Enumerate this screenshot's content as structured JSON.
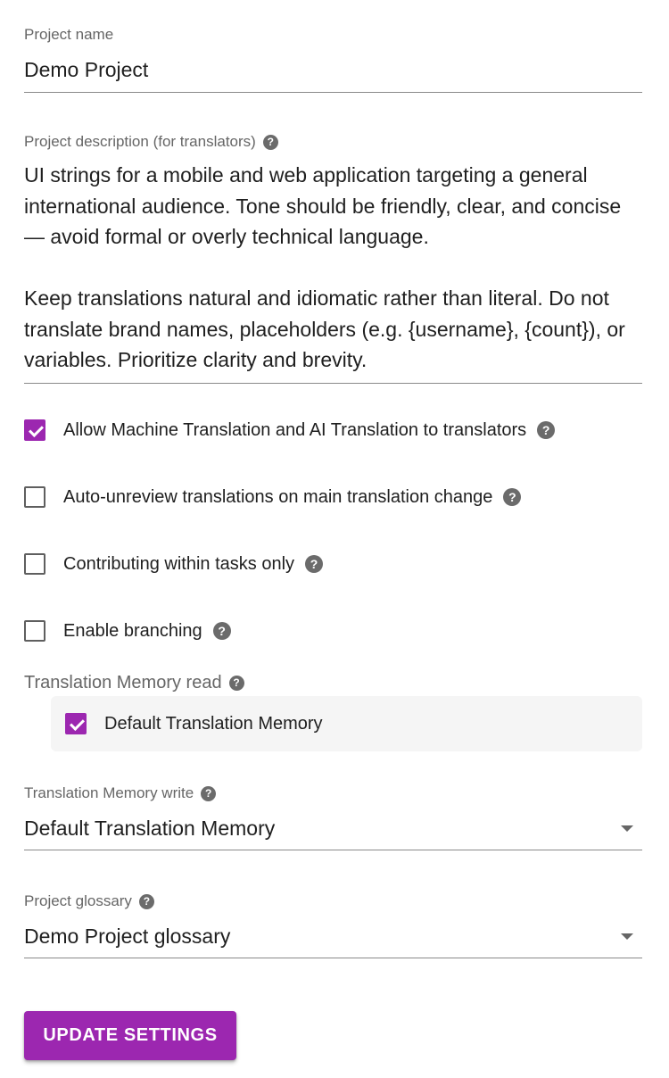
{
  "project_name": {
    "label": "Project name",
    "value": "Demo Project"
  },
  "project_description": {
    "label": "Project description (for translators)",
    "paragraphs": [
      "UI strings for a mobile and web application targeting a general international audience. Tone should be friendly, clear, and concise — avoid formal or overly technical language.",
      "Keep translations natural and idiomatic rather than literal. Do not translate brand names, placeholders (e.g. {username}, {count}), or variables. Prioritize clarity and brevity."
    ]
  },
  "options": {
    "machine_translation": {
      "label": "Allow Machine Translation and AI Translation to translators",
      "checked": true
    },
    "auto_unreview": {
      "label": "Auto-unreview translations on main translation change",
      "checked": false
    },
    "tasks_only": {
      "label": "Contributing within tasks only",
      "checked": false
    },
    "branching": {
      "label": "Enable branching",
      "checked": false
    }
  },
  "tm_read": {
    "label": "Translation Memory read",
    "items": [
      {
        "label": "Default Translation Memory",
        "checked": true
      }
    ]
  },
  "tm_write": {
    "label": "Translation Memory write",
    "value": "Default Translation Memory"
  },
  "glossary": {
    "label": "Project glossary",
    "value": "Demo Project glossary"
  },
  "actions": {
    "update_label": "UPDATE SETTINGS"
  },
  "icons": {
    "help": "help-circle-icon",
    "help_glyph": "?"
  },
  "colors": {
    "accent": "#9c27b0",
    "help_icon": "#6b6b6b",
    "label": "#666666"
  }
}
